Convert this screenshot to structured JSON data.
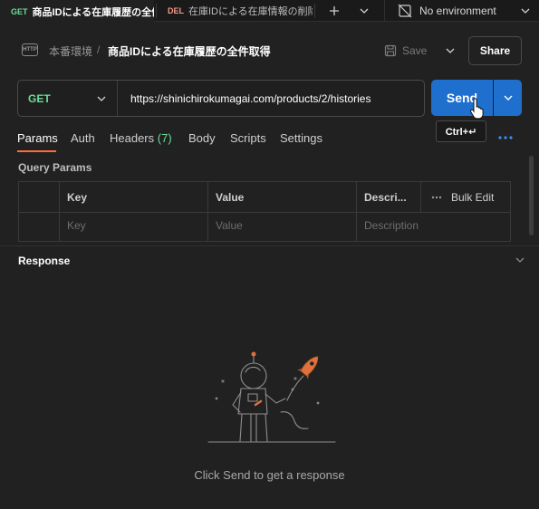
{
  "tabs": [
    {
      "method": "GET",
      "name": "商品IDによる在庫履歴の全件"
    },
    {
      "method": "DEL",
      "name": "在庫IDによる在庫情報の削除"
    }
  ],
  "environment": {
    "label": "No environment"
  },
  "breadcrumb": {
    "parent": "本番環境",
    "separator": "/",
    "title": "商品IDによる在庫履歴の全件取得"
  },
  "header": {
    "save_label": "Save",
    "share_label": "Share"
  },
  "request": {
    "method": "GET",
    "url": "https://shinichirokumagai.com/products/2/histories",
    "send_label": "Send",
    "shortcut_tooltip": "Ctrl+↵"
  },
  "request_tabs": {
    "params": "Params",
    "auth": "Auth",
    "headers": "Headers",
    "headers_count": "(7)",
    "body": "Body",
    "scripts": "Scripts",
    "settings": "Settings"
  },
  "query_params": {
    "label": "Query Params",
    "columns": {
      "key": "Key",
      "value": "Value",
      "description": "Descri..."
    },
    "bulk_edit": "Bulk Edit",
    "placeholders": {
      "key": "Key",
      "value": "Value",
      "description": "Description"
    }
  },
  "response": {
    "label": "Response",
    "empty_text": "Click Send to get a response"
  },
  "colors": {
    "accent": "#ff6c37",
    "get": "#6bdd9a",
    "delete": "#f79a8e",
    "primary": "#1f6fcf"
  },
  "icons": [
    "plus-icon",
    "chevron-down-icon",
    "no-environment-icon",
    "http-icon",
    "save-icon",
    "more-icon",
    "hand-cursor-icon",
    "astronaut-rocket-illustration"
  ]
}
